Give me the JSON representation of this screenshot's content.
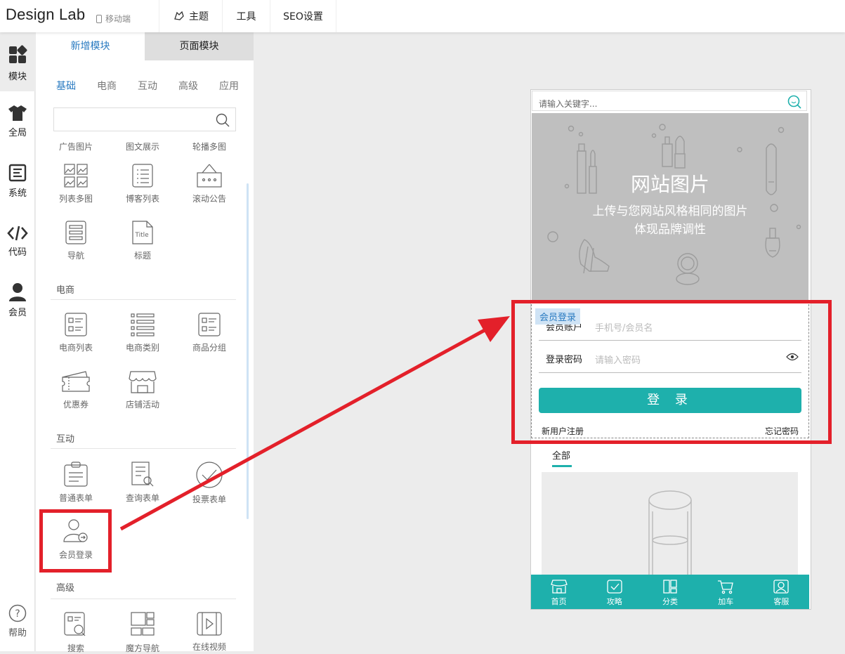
{
  "app": {
    "logo": "Design Lab",
    "device": "移动端",
    "nav": [
      "主题",
      "工具",
      "SEO设置"
    ]
  },
  "rail": [
    {
      "label": "模块",
      "icon": "modules-icon"
    },
    {
      "label": "全局",
      "icon": "shirt-icon"
    },
    {
      "label": "系统",
      "icon": "document-icon"
    },
    {
      "label": "代码",
      "icon": "code-icon"
    },
    {
      "label": "会员",
      "icon": "user-icon"
    },
    {
      "label": "帮助",
      "icon": "help-icon"
    }
  ],
  "panel": {
    "tabs": [
      "新增模块",
      "页面模块"
    ],
    "categories": [
      "基础",
      "电商",
      "互动",
      "高级",
      "应用"
    ],
    "basic_top_labels": [
      "广告图片",
      "图文展示",
      "轮播多图"
    ],
    "basic_items": [
      "列表多图",
      "博客列表",
      "滚动公告",
      "导航",
      "标题"
    ],
    "sections": [
      "电商",
      "互动",
      "高级"
    ],
    "ecommerce_items": [
      "电商列表",
      "电商类别",
      "商品分组",
      "优惠券",
      "店铺活动"
    ],
    "interactive_items": [
      "普通表单",
      "查询表单",
      "投票表单",
      "会员登录"
    ],
    "advanced_items": [
      "搜索",
      "魔方导航",
      "在线视频"
    ],
    "title_icon_text": "Title"
  },
  "phone": {
    "search_placeholder": "请输入关键字...",
    "banner": {
      "title": "网站图片",
      "line1": "上传与您网站风格相同的图片",
      "line2": "体现品牌调性"
    },
    "login": {
      "tag": "会员登录",
      "account_label": "会员账户",
      "account_placeholder": "手机号/会员名",
      "password_label": "登录密码",
      "password_placeholder": "请输入密码",
      "button": "登 录",
      "register": "新用户注册",
      "forgot": "忘记密码"
    },
    "content_tab": "全部",
    "bottom_nav": [
      "首页",
      "攻略",
      "分类",
      "加车",
      "客服"
    ]
  },
  "colors": {
    "accent": "#1eb0ac",
    "highlight": "#e3202a",
    "link": "#2a7bc1"
  }
}
